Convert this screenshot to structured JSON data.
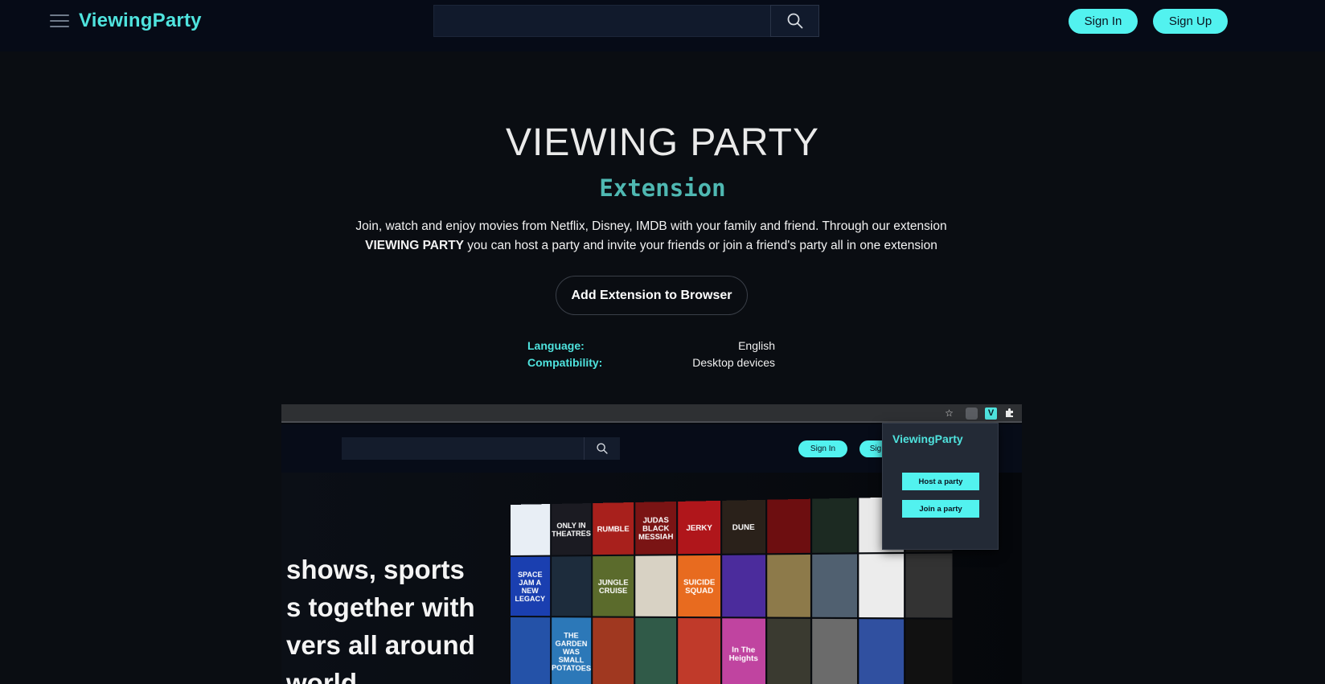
{
  "header": {
    "logo": "ViewingParty",
    "search_placeholder": "",
    "sign_in": "Sign In",
    "sign_up": "Sign Up"
  },
  "hero": {
    "title": "VIEWING PARTY",
    "subtitle": "Extension",
    "description_line1": "Join, watch and enjoy movies from Netflix, Disney, IMDB with your family and friend. Through our extension",
    "description_brand": "VIEWING PARTY",
    "description_line2": " you can host a party and invite your friends or join a friend's party all in one extension",
    "cta": "Add Extension to Browser"
  },
  "meta": [
    {
      "label": "Language:",
      "value": "English"
    },
    {
      "label": "Compatibility:",
      "value": "Desktop devices"
    }
  ],
  "preview": {
    "sign_in": "Sign In",
    "sign_up_partial": "Sig",
    "headline_lines": [
      "shows, sports",
      "s together with",
      "vers all around",
      "world"
    ],
    "popup": {
      "title": "ViewingParty",
      "host": "Host a party",
      "join": "Join a party"
    },
    "posters": [
      {
        "text": "",
        "color": "#e8eef5"
      },
      {
        "text": "ONLY IN THEATRES",
        "color": "#1b1b22"
      },
      {
        "text": "RUMBLE",
        "color": "#a8201c"
      },
      {
        "text": "JUDAS BLACK MESSIAH",
        "color": "#7a1414"
      },
      {
        "text": "JERKY",
        "color": "#b0161b"
      },
      {
        "text": "DUNE",
        "color": "#2a211a"
      },
      {
        "text": "",
        "color": "#6d0e10"
      },
      {
        "text": "",
        "color": "#1c2a22"
      },
      {
        "text": "",
        "color": "#e9e9e9"
      },
      {
        "text": "",
        "color": "#222"
      },
      {
        "text": "SPACE JAM A NEW LEGACY",
        "color": "#1a3fb0"
      },
      {
        "text": "",
        "color": "#1d2c3c"
      },
      {
        "text": "JUNGLE CRUISE",
        "color": "#5b6b2c"
      },
      {
        "text": "",
        "color": "#d8d2c4"
      },
      {
        "text": "SUICIDE SQUAD",
        "color": "#e86b1f"
      },
      {
        "text": "",
        "color": "#4b2c9c"
      },
      {
        "text": "",
        "color": "#8d7a4a"
      },
      {
        "text": "",
        "color": "#506070"
      },
      {
        "text": "",
        "color": "#ececec"
      },
      {
        "text": "",
        "color": "#333"
      },
      {
        "text": "",
        "color": "#2452a8"
      },
      {
        "text": "THE GARDEN WAS SMALL POTATOES",
        "color": "#2c78b8"
      },
      {
        "text": "",
        "color": "#a03820"
      },
      {
        "text": "",
        "color": "#305a48"
      },
      {
        "text": "",
        "color": "#c03a2a"
      },
      {
        "text": "In The Heights",
        "color": "#c044a0"
      },
      {
        "text": "",
        "color": "#3a3a30"
      },
      {
        "text": "",
        "color": "#6b6b6b"
      },
      {
        "text": "",
        "color": "#3050a0"
      },
      {
        "text": "",
        "color": "#111"
      }
    ]
  },
  "colors": {
    "accent": "#52f2ef",
    "accent_text": "#4fe3de",
    "background": "#0a0d12",
    "nav": "#060b17"
  }
}
